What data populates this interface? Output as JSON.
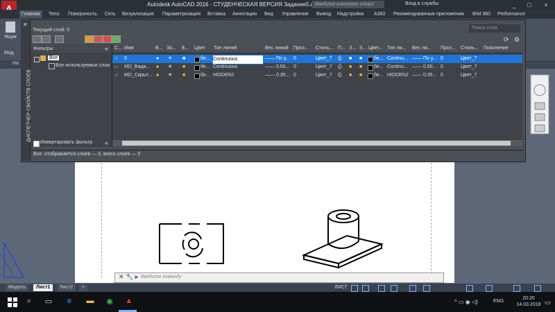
{
  "window": {
    "title": "Autodesk AutoCAD 2016 - СТУДЕНЧЕСКАЯ ВЕРСИЯ    Задание5.dwg",
    "search_placeholder": "Введите ключевое слово/фразу",
    "login": "Вход в службы",
    "buttons": [
      "_",
      "□",
      "×"
    ]
  },
  "ribbon": {
    "tabs": [
      "Главная",
      "Тело",
      "Поверхность",
      "Сеть",
      "Визуализация",
      "Параметризация",
      "Вставка",
      "Аннотации",
      "Вид",
      "Управление",
      "Вывод",
      "Надстройки",
      "A360",
      "Рекомендованные приложения",
      "BIM 360",
      "Performance"
    ],
    "tool_label": "Ящик",
    "tool_label2": "Мод",
    "tab_label": "На"
  },
  "layer_manager": {
    "strip_title": "ДИСПЕТЧЕР СВОЙСТВ СЛОЕВ",
    "current_layer": "Текущий слой: 0",
    "search_placeholder": "Поиск слоя",
    "filters_title": "Фильтры",
    "tree": {
      "all": "Все",
      "used": "Все используемые слои"
    },
    "invert_filter": "Инвертировать фильтр",
    "status": "Всe: отображается слоев — 3, всего слоев — 3",
    "columns": [
      "С...",
      "Имя",
      "В...",
      "За...",
      "Б...",
      "Цвет",
      "Тип линий",
      "Вес линий",
      "Проз...",
      "Стиль...",
      "П...",
      "З...",
      "З...",
      "Цвет...",
      "Тип ли...",
      "Вес ли...",
      "Проз...",
      "Стиль...",
      "Пояснение"
    ],
    "rows": [
      {
        "name": "0",
        "color": "бе...",
        "linetype": "Continuous",
        "lineweight": "—— По у...",
        "transparency": "0",
        "plotstyle": "Цвет_7",
        "vp_color": "бе...",
        "vp_linetype": "Continu...",
        "vp_lineweight": "—— По у...",
        "vp_transparency": "0",
        "vp_plotstyle": "Цвет_7",
        "selected": true
      },
      {
        "name": "MD_Види...",
        "color": "бе...",
        "linetype": "Continuous",
        "lineweight": "—— 0.50...",
        "transparency": "0",
        "plotstyle": "Цвет_7",
        "vp_color": "бе...",
        "vp_linetype": "Continu...",
        "vp_lineweight": "—— 0.50...",
        "vp_transparency": "0",
        "vp_plotstyle": "Цвет_7",
        "selected": false
      },
      {
        "name": "MD_Скрыт...",
        "color": "бе...",
        "linetype": "HIDDEN2",
        "lineweight": "—— 0.35...",
        "transparency": "0",
        "plotstyle": "Цвет_7",
        "vp_color": "бе...",
        "vp_linetype": "HIDDEN2",
        "vp_lineweight": "—— 0.35...",
        "vp_transparency": "0",
        "vp_plotstyle": "Цвет_7",
        "selected": false
      }
    ]
  },
  "command_line": {
    "placeholder": "Введите команду"
  },
  "layout_tabs": [
    "Модель",
    "Лист1",
    "Лист2",
    "+"
  ],
  "status_bar": {
    "mode": "ЛИСТ"
  },
  "taskbar": {
    "language": "ENG",
    "time": "20:20",
    "date": "14.03.2018"
  }
}
